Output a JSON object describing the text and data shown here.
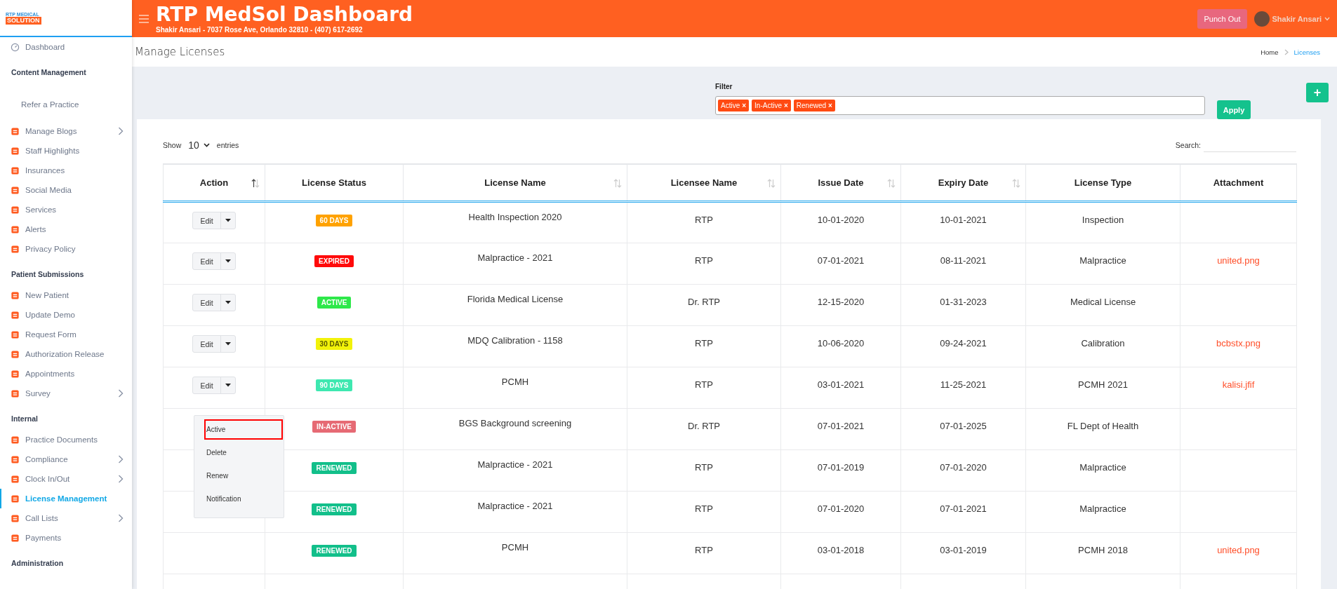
{
  "logo": {
    "top": "RTP MEDICAL",
    "bottom": "SOLUTION"
  },
  "sidebar": {
    "sections": [
      {
        "items": [
          {
            "label": "Dashboard",
            "kind": "gauge",
            "selected": false,
            "has_submenu": false
          }
        ]
      },
      {
        "title": "Content Management",
        "items": [
          {
            "label": "Refer a Practice",
            "kind": "plain",
            "selected": false,
            "has_submenu": false
          },
          {
            "label": "Manage Blogs",
            "kind": "icon",
            "selected": false,
            "has_submenu": true
          },
          {
            "label": "Staff Highlights",
            "kind": "icon",
            "selected": false,
            "has_submenu": false
          },
          {
            "label": "Insurances",
            "kind": "icon",
            "selected": false,
            "has_submenu": false
          },
          {
            "label": "Social Media",
            "kind": "icon",
            "selected": false,
            "has_submenu": false
          },
          {
            "label": "Services",
            "kind": "icon",
            "selected": false,
            "has_submenu": false
          },
          {
            "label": "Alerts",
            "kind": "icon",
            "selected": false,
            "has_submenu": false
          },
          {
            "label": "Privacy Policy",
            "kind": "icon",
            "selected": false,
            "has_submenu": false
          }
        ]
      },
      {
        "title": "Patient Submissions",
        "items": [
          {
            "label": "New Patient",
            "kind": "icon",
            "selected": false,
            "has_submenu": false
          },
          {
            "label": "Update Demo",
            "kind": "icon",
            "selected": false,
            "has_submenu": false
          },
          {
            "label": "Request Form",
            "kind": "icon",
            "selected": false,
            "has_submenu": false
          },
          {
            "label": "Authorization Release",
            "kind": "icon",
            "selected": false,
            "has_submenu": false
          },
          {
            "label": "Appointments",
            "kind": "icon",
            "selected": false,
            "has_submenu": false
          },
          {
            "label": "Survey",
            "kind": "icon",
            "selected": false,
            "has_submenu": true
          }
        ]
      },
      {
        "title": "Internal",
        "items": [
          {
            "label": "Practice Documents",
            "kind": "icon",
            "selected": false,
            "has_submenu": false
          },
          {
            "label": "Compliance",
            "kind": "icon",
            "selected": false,
            "has_submenu": true
          },
          {
            "label": "Clock In/Out",
            "kind": "icon",
            "selected": false,
            "has_submenu": true
          },
          {
            "label": "License Management",
            "kind": "icon",
            "selected": true,
            "has_submenu": false
          },
          {
            "label": "Call Lists",
            "kind": "icon",
            "selected": false,
            "has_submenu": true
          },
          {
            "label": "Payments",
            "kind": "icon",
            "selected": false,
            "has_submenu": false
          }
        ]
      },
      {
        "title": "Administration"
      }
    ]
  },
  "header": {
    "title": "RTP MedSol Dashboard",
    "subtitle": "Shakir Ansari - 7037 Rose Ave, Orlando 32810 - (407) 617-2692",
    "punch_button": "Punch Out",
    "user": "Shakir Ansari"
  },
  "page": {
    "title": "Manage Licenses",
    "breadcrumb": [
      {
        "label": "Home",
        "selected": false
      },
      {
        "label": "Licenses",
        "selected": true
      }
    ]
  },
  "filter": {
    "label": "Filter",
    "tags": [
      {
        "label": "Active",
        "remove": "×"
      },
      {
        "label": "In-Active",
        "remove": "×"
      },
      {
        "label": "Renewed",
        "remove": "×"
      }
    ],
    "apply_button": "Apply",
    "add_button": "+"
  },
  "table": {
    "show_label": "Show",
    "page_size": "10",
    "entries_label": "entries",
    "search_label": "Search:",
    "columns": [
      {
        "label": "Action",
        "sortable": true,
        "sorted": true
      },
      {
        "label": "License Status",
        "sortable": false
      },
      {
        "label": "License Name",
        "sortable": true,
        "sorted": false
      },
      {
        "label": "Licensee Name",
        "sortable": true,
        "sorted": false
      },
      {
        "label": "Issue Date",
        "sortable": true,
        "sorted": false
      },
      {
        "label": "Expiry Date",
        "sortable": true,
        "sorted": false
      },
      {
        "label": "License Type",
        "sortable": false
      },
      {
        "label": "Attachment",
        "sortable": false
      }
    ],
    "action_menu": {
      "items": [
        {
          "label": "Active",
          "selected": true
        },
        {
          "label": "Delete",
          "selected": false
        },
        {
          "label": "Renew",
          "selected": false
        },
        {
          "label": "Notification",
          "selected": false
        }
      ]
    },
    "rows": [
      {
        "edit_button": "Edit",
        "menu_open": false,
        "status": {
          "label": "60 DAYS",
          "color": "#ffa200"
        },
        "name": "Health Inspection 2020",
        "licensee": "RTP",
        "issue": "10-01-2020",
        "expiry": "10-01-2021",
        "type": "Inspection"
      },
      {
        "edit_button": "Edit",
        "menu_open": false,
        "status": {
          "label": "EXPIRED",
          "color": "#ff0a0a"
        },
        "name": "Malpractice - 2021",
        "licensee": "RTP",
        "issue": "07-01-2021",
        "expiry": "08-11-2021",
        "type": "Malpractice",
        "attachment": "united.png"
      },
      {
        "edit_button": "Edit",
        "menu_open": false,
        "status": {
          "label": "ACTIVE",
          "color": "#2ee84a"
        },
        "name": "Florida Medical License",
        "licensee": "Dr. RTP",
        "issue": "12-15-2020",
        "expiry": "01-31-2023",
        "type": "Medical License"
      },
      {
        "edit_button": "Edit",
        "menu_open": false,
        "status": {
          "label": "30 DAYS",
          "color": "#f2f20a"
        },
        "name": "MDQ Calibration - 1158",
        "licensee": "RTP",
        "issue": "10-06-2020",
        "expiry": "09-24-2021",
        "type": "Calibration",
        "attachment": "bcbstx.png"
      },
      {
        "edit_button": "Edit",
        "menu_open": false,
        "status": {
          "label": "90 DAYS",
          "color": "#3ee8b0"
        },
        "name": "PCMH",
        "licensee": "RTP",
        "issue": "03-01-2021",
        "expiry": "11-25-2021",
        "type": "PCMH 2021",
        "attachment": "kalisi.jfif"
      },
      {
        "menu_open": true,
        "status": {
          "label": "IN-ACTIVE",
          "color": "#e66a74"
        },
        "name": "BGS Background screening",
        "licensee": "Dr. RTP",
        "issue": "07-01-2021",
        "expiry": "07-01-2025",
        "type": "FL Dept of Health"
      },
      {
        "menu_open": false,
        "status": {
          "label": "RENEWED",
          "color": "#12bf8a"
        },
        "name": "Malpractice - 2021",
        "licensee": "RTP",
        "issue": "07-01-2019",
        "expiry": "07-01-2020",
        "type": "Malpractice"
      },
      {
        "menu_open": false,
        "status": {
          "label": "RENEWED",
          "color": "#12bf8a"
        },
        "name": "Malpractice - 2021",
        "licensee": "RTP",
        "issue": "07-01-2020",
        "expiry": "07-01-2021",
        "type": "Malpractice"
      },
      {
        "menu_open": false,
        "status": {
          "label": "RENEWED",
          "color": "#12bf8a"
        },
        "name": "PCMH",
        "licensee": "RTP",
        "issue": "03-01-2018",
        "expiry": "03-01-2019",
        "type": "PCMH 2018",
        "attachment": "united.png"
      },
      {
        "menu_open": false
      }
    ]
  }
}
